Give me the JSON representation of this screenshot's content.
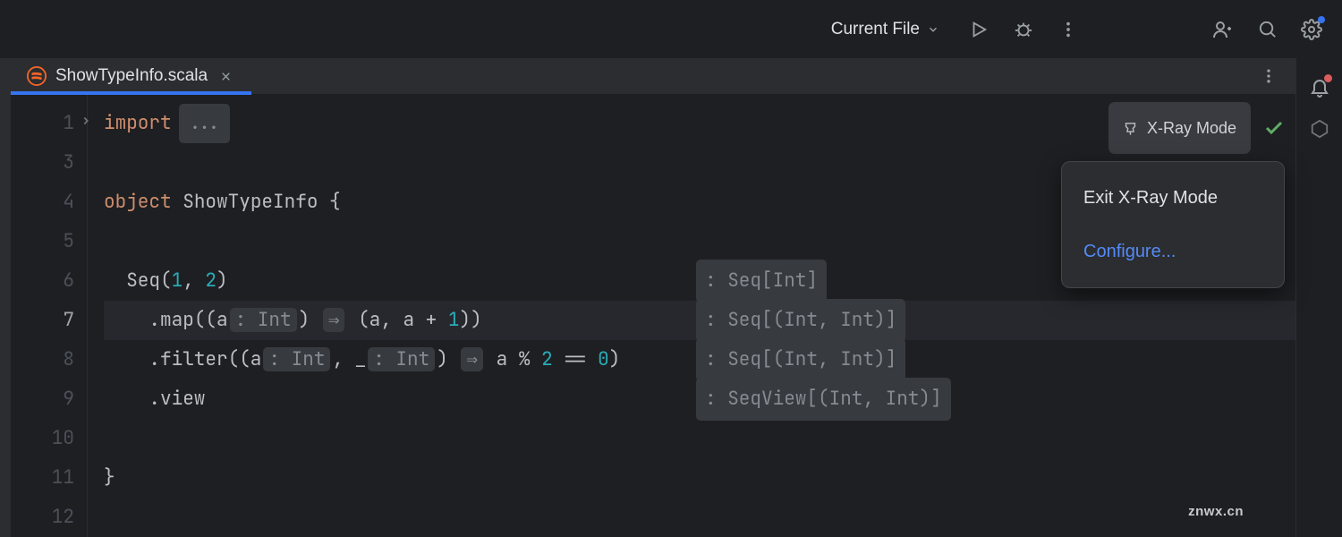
{
  "toolbar": {
    "run_config": "Current File"
  },
  "tab": {
    "filename": "ShowTypeInfo.scala"
  },
  "gutter": {
    "lines": [
      "1",
      "3",
      "4",
      "5",
      "6",
      "7",
      "8",
      "9",
      "10",
      "11",
      "12"
    ],
    "caret_line_index": 4
  },
  "code": {
    "l1_import": "import",
    "l1_fold": "...",
    "l4_object": "object",
    "l4_name": "ShowTypeInfo",
    "l4_brace": " {",
    "l6_pre": "  Seq(",
    "l6_n1": "1",
    "l6_c": ", ",
    "l6_n2": "2",
    "l6_post": ")",
    "l6_type": ": Seq[Int]",
    "l7_pre": "    .map((a",
    "l7_h1": ": Int",
    "l7_mid1": ") ",
    "l7_arrow": "⇒",
    "l7_mid2": " (a, a + ",
    "l7_n": "1",
    "l7_post": "))",
    "l7_type": ": Seq[(Int, Int)]",
    "l8_pre": "    .filter((a",
    "l8_h1": ": Int",
    "l8_c1": ", _",
    "l8_h2": ": Int",
    "l8_mid1": ") ",
    "l8_arrow": "⇒",
    "l8_mid2": " a % ",
    "l8_n1": "2",
    "l8_eq": " == ",
    "l8_n2": "0",
    "l8_post": ")",
    "l8_type": ": Seq[(Int, Int)]",
    "l9_pre": "    .view",
    "l9_type": ": SeqView[(Int, Int)]",
    "l11": "}"
  },
  "xray": {
    "label": "X-Ray Mode"
  },
  "popup": {
    "exit": "Exit X-Ray Mode",
    "configure": "Configure..."
  },
  "watermark": "znwx.cn"
}
